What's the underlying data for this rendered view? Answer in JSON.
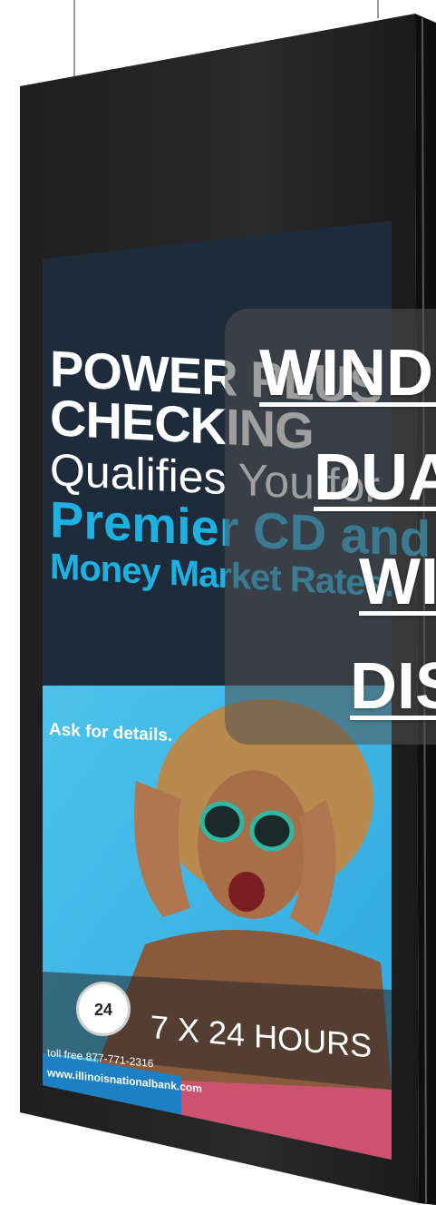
{
  "colors": {
    "bezel": "#242424",
    "screen_dark": "#1d2b3a",
    "accent_blue": "#1fb0e2",
    "photo_bg": "#42b8e6",
    "overlay": "#505050"
  },
  "ad": {
    "line1": "POWER PLUS",
    "line2": "CHECKING",
    "line3": "Qualifies You for",
    "line4": "Premier CD and",
    "line5": "Money Market Rates.",
    "ask": "Ask for details.",
    "badge": "24",
    "hours": "7 X 24 HOURS",
    "toll": "toll free 877-771-2316",
    "website": "www.illinoisnationalbank.com"
  },
  "overlay": {
    "line1": "WINDOW",
    "line2": "DUAL",
    "line3": "WINDOW",
    "line4": "DISPLAY"
  }
}
